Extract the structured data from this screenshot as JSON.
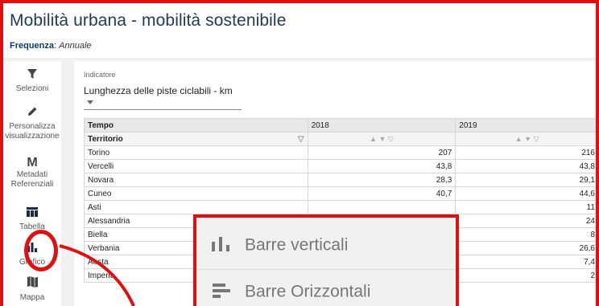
{
  "header": {
    "title": "Mobilità urbana - mobilità sostenibile",
    "frequency_label": "Frequenza",
    "frequency_value": "Annuale"
  },
  "sidebar": {
    "items": [
      {
        "label": "Selezioni",
        "icon": "filter-icon"
      },
      {
        "label": "Personalizza visualizzazione",
        "icon": "pencil-icon"
      },
      {
        "label": "Metadati Referenziali",
        "icon": "metadata-m-icon",
        "glyph": "M"
      },
      {
        "label": "Tabella",
        "icon": "table-icon"
      },
      {
        "label": "Grafico",
        "icon": "bar-chart-icon"
      },
      {
        "label": "Mappa",
        "icon": "map-icon"
      }
    ]
  },
  "indicator": {
    "label": "Indicatore",
    "value": "Lunghezza delle piste ciclabili - km"
  },
  "table": {
    "col_tempo": "Tempo",
    "col_territorio": "Territorio",
    "years": [
      "2018",
      "2019"
    ],
    "rows": [
      {
        "name": "Torino",
        "v2018": "207",
        "v2019": "216"
      },
      {
        "name": "Vercelli",
        "v2018": "43,8",
        "v2019": "43,8"
      },
      {
        "name": "Novara",
        "v2018": "28,3",
        "v2019": "29,1"
      },
      {
        "name": "Cuneo",
        "v2018": "40,7",
        "v2019": "44,6"
      },
      {
        "name": "Asti",
        "v2018": "",
        "v2019": "11"
      },
      {
        "name": "Alessandria",
        "v2018": "",
        "v2019": "24"
      },
      {
        "name": "Biella",
        "v2018": "",
        "v2019": "8"
      },
      {
        "name": "Verbania",
        "v2018": "",
        "v2019": "26,6"
      },
      {
        "name": "Aosta",
        "v2018": "",
        "v2019": "7,4"
      },
      {
        "name": "Imperia",
        "v2018": "",
        "v2019": "2"
      }
    ]
  },
  "chart_menu": {
    "items": [
      {
        "label": "Barre verticali",
        "icon": "vertical-bars-icon"
      },
      {
        "label": "Barre Orizzontali",
        "icon": "horizontal-bars-icon"
      }
    ]
  },
  "colors": {
    "annotation_red": "#e01010",
    "title_blue": "#1f3a5a"
  }
}
